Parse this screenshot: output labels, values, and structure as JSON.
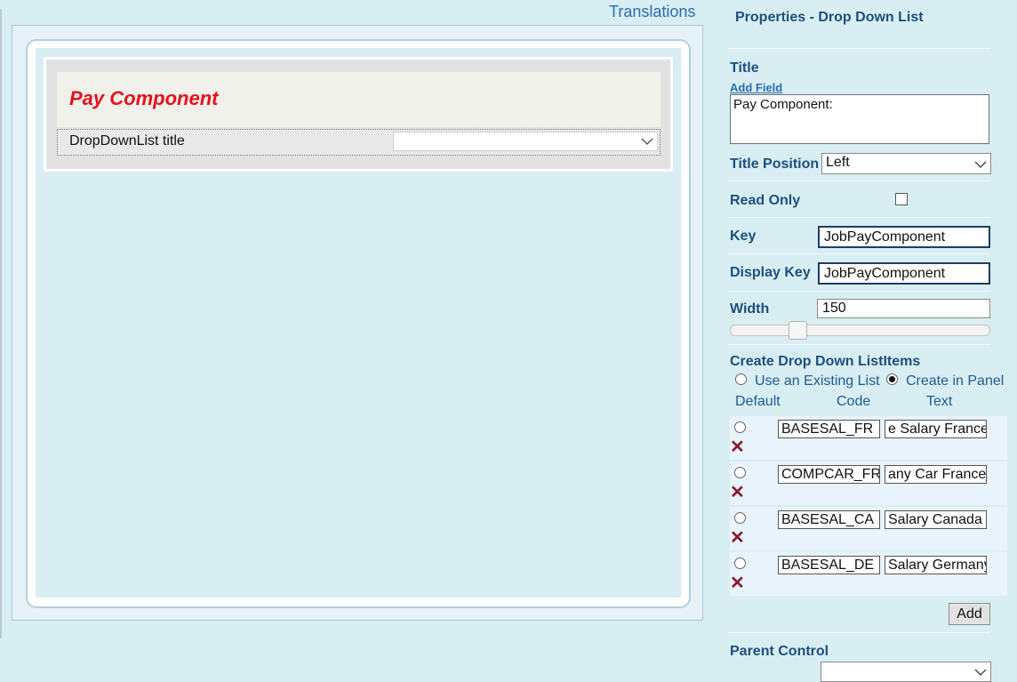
{
  "left": {
    "translations_label": "Translations",
    "form": {
      "title": "Pay Component",
      "row_label": "DropDownList title",
      "select_value": ""
    }
  },
  "properties": {
    "heading": "Properties - Drop Down List",
    "title_label": "Title",
    "add_field_label": "Add Field",
    "title_value": "Pay Component:",
    "title_position_label": "Title Position",
    "title_position_value": "Left",
    "read_only_label": "Read Only",
    "read_only_checked": false,
    "key_label": "Key",
    "key_value": "JobPayComponent",
    "display_key_label": "Display Key",
    "display_key_value": "JobPayComponent",
    "width_label": "Width",
    "width_value": "150",
    "create_items_label": "Create Drop Down ListItems",
    "option_existing": "Use an Existing List",
    "option_panel": "Create in Panel",
    "selected_option": "panel",
    "columns": {
      "default": "Default",
      "code": "Code",
      "text": "Text"
    },
    "items": [
      {
        "code": "BASESAL_FR",
        "text": "e Salary France"
      },
      {
        "code": "COMPCAR_FR",
        "text": "any Car France"
      },
      {
        "code": "BASESAL_CA",
        "text": " Salary Canada"
      },
      {
        "code": "BASESAL_DE",
        "text": "Salary Germany"
      }
    ],
    "add_button": "Add",
    "parent_control_label": "Parent Control",
    "parent_control_value": ""
  },
  "colors": {
    "background": "#d8eef2",
    "label_blue": "#1d4f7f",
    "link_blue": "#2a6db3",
    "form_title_red": "#e8101a",
    "delete_red": "#8b1a2b"
  },
  "icons": {
    "select_arrow": "chevron-down-icon",
    "delete": "delete-x-icon"
  }
}
